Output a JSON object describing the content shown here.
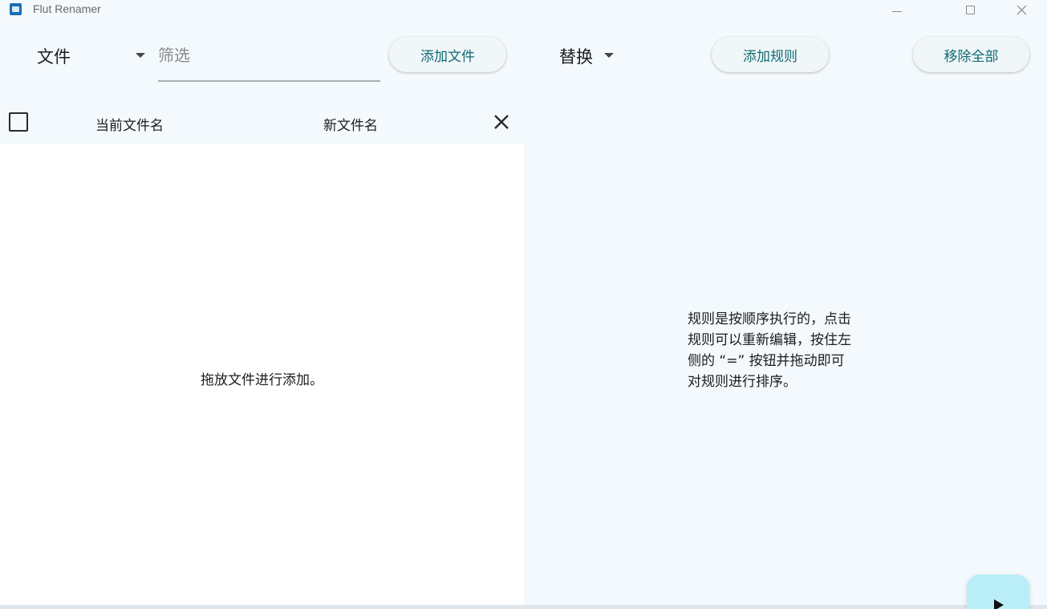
{
  "window": {
    "title": "Flut Renamer"
  },
  "toolbar": {
    "file_mode_label": "文件",
    "filter_placeholder": "筛选",
    "add_file_label": "添加文件",
    "replace_label": "替换",
    "add_rule_label": "添加规则",
    "remove_all_label": "移除全部"
  },
  "file_table": {
    "columns": [
      "当前文件名",
      "新文件名"
    ],
    "empty_hint": "拖放文件进行添加。"
  },
  "rules_panel": {
    "hint_lines": [
      "规则是按顺序执行的，点击",
      "规则可以重新编辑，按住左",
      "侧的 “=” 按钮并拖动即可",
      "对规则进行排序。"
    ]
  },
  "icons": {
    "app": "app-icon",
    "minimize": "minimize-icon",
    "maximize": "maximize-icon",
    "close": "close-icon",
    "dropdown": "chevron-down-icon",
    "clear": "close-icon",
    "run": "play-icon"
  },
  "colors": {
    "background": "#f3f9fc",
    "accent_text": "#0f6b74",
    "fab": "#b9eef8",
    "list_background": "#ffffff"
  }
}
